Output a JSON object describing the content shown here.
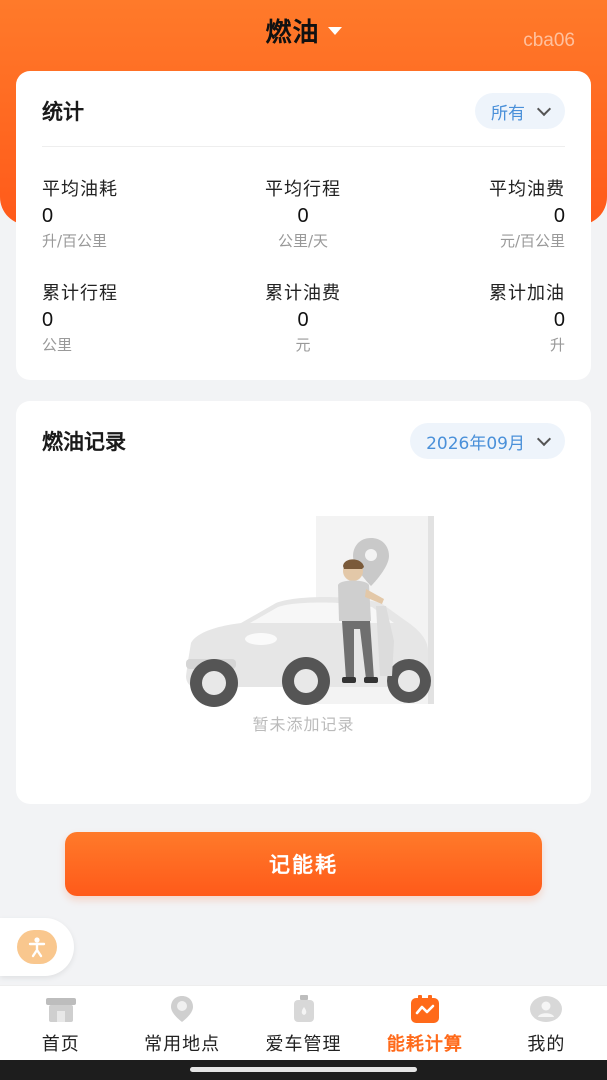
{
  "header": {
    "title": "燃油",
    "watermark": "cba06"
  },
  "stats": {
    "title": "统计",
    "filter": "所有",
    "items": [
      {
        "label": "平均油耗",
        "value": "0",
        "unit": "升/百公里"
      },
      {
        "label": "平均行程",
        "value": "0",
        "unit": "公里/天"
      },
      {
        "label": "平均油费",
        "value": "0",
        "unit": "元/百公里"
      },
      {
        "label": "累计行程",
        "value": "0",
        "unit": "公里"
      },
      {
        "label": "累计油费",
        "value": "0",
        "unit": "元"
      },
      {
        "label": "累计加油",
        "value": "0",
        "unit": "升"
      }
    ]
  },
  "records": {
    "title": "燃油记录",
    "month": "2026年09月",
    "empty_text": "暂未添加记录"
  },
  "action": {
    "label": "记能耗"
  },
  "tabbar": {
    "items": [
      {
        "label": "首页",
        "icon": "home-icon"
      },
      {
        "label": "常用地点",
        "icon": "location-icon"
      },
      {
        "label": "爱车管理",
        "icon": "car-manage-icon"
      },
      {
        "label": "能耗计算",
        "icon": "energy-calc-icon"
      },
      {
        "label": "我的",
        "icon": "profile-icon"
      }
    ],
    "active_index": 3
  },
  "colors": {
    "accent": "#ff6a1a",
    "pill_text": "#4a90d9"
  }
}
